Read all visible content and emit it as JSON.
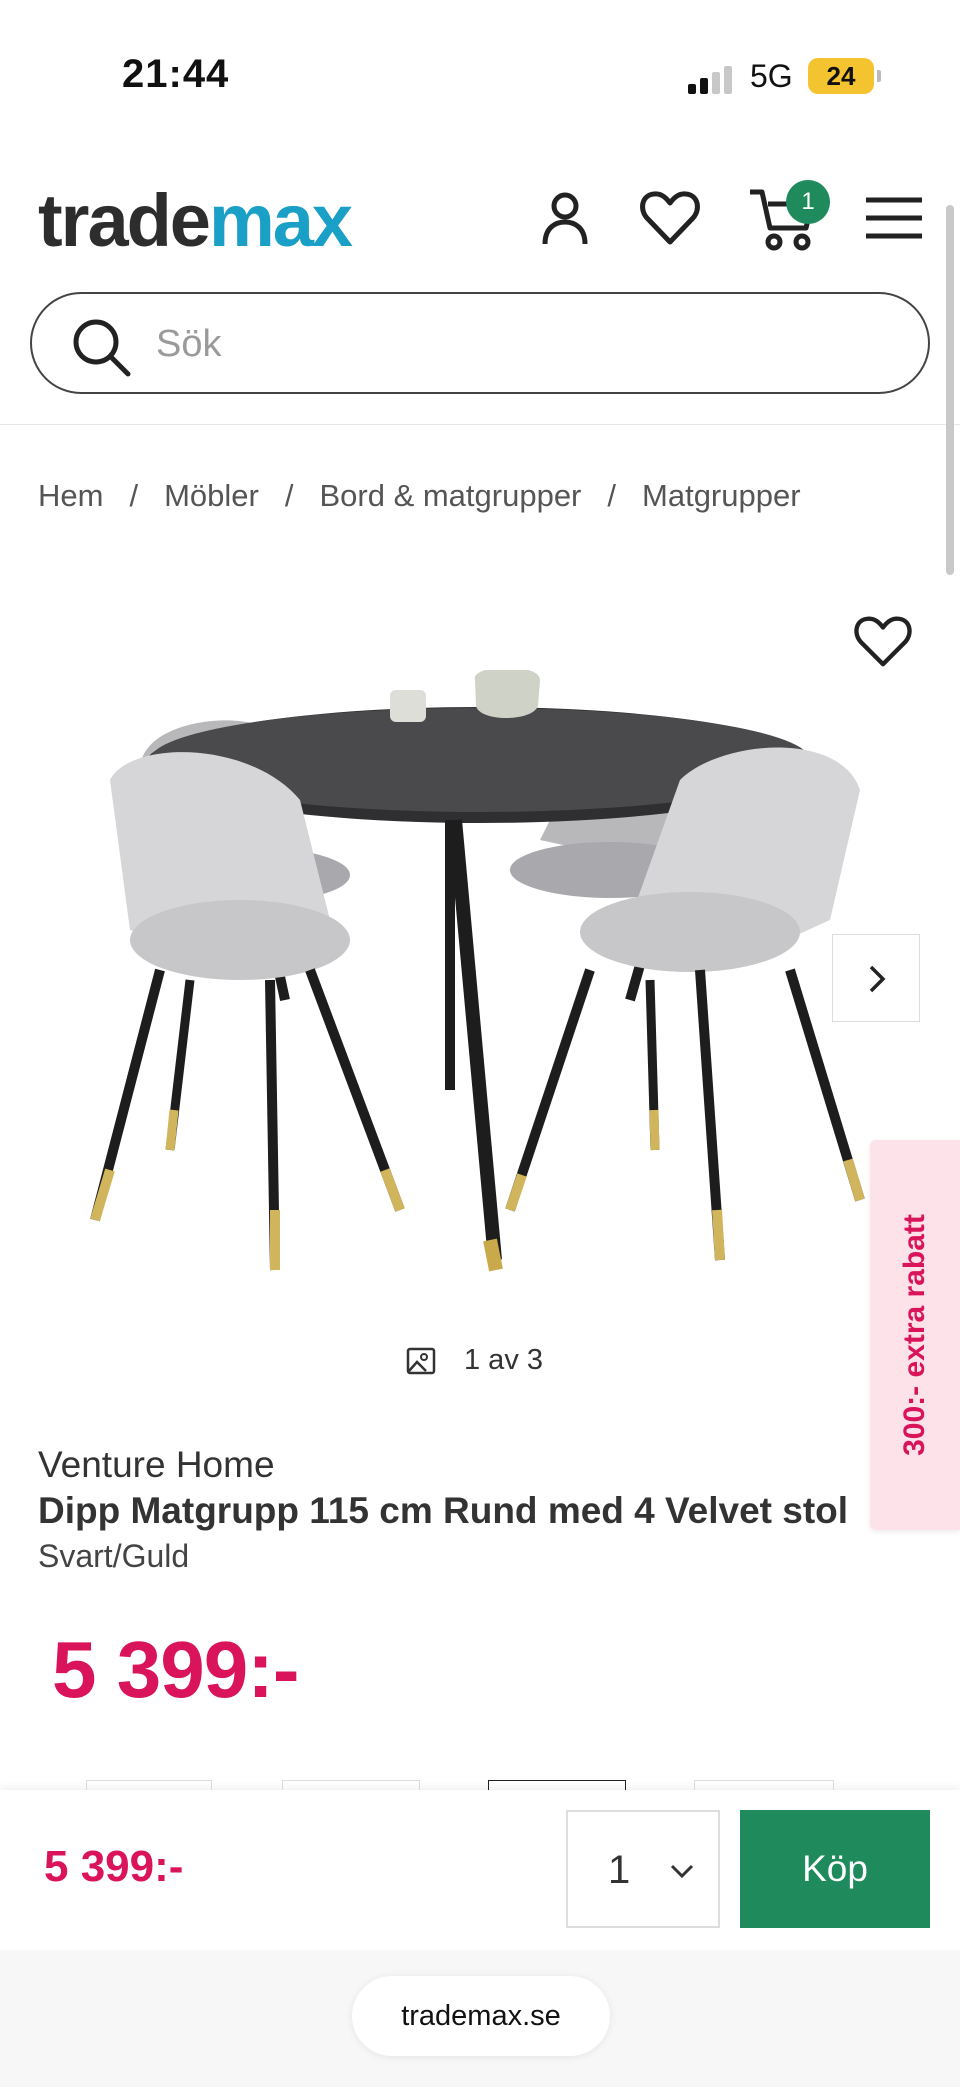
{
  "status_bar": {
    "time": "21:44",
    "network": "5G",
    "battery": "24"
  },
  "header": {
    "logo_part1": "trade",
    "logo_part2": "max",
    "cart_count": "1",
    "icons": [
      "account-icon",
      "heart-icon",
      "cart-icon",
      "menu-icon"
    ]
  },
  "search": {
    "placeholder": "Sök"
  },
  "breadcrumb": [
    {
      "label": "Hem"
    },
    {
      "label": "Möbler"
    },
    {
      "label": "Bord & matgrupper"
    },
    {
      "label": "Matgrupper"
    }
  ],
  "gallery": {
    "counter": "1 av 3",
    "promo": "300:- extra rabatt"
  },
  "product": {
    "brand": "Venture Home",
    "title": "Dipp Matgrupp 115 cm Rund med 4 Velvet stol",
    "color": "Svart/Guld",
    "price": "5 399:-"
  },
  "buy_bar": {
    "price": "5 399:-",
    "quantity": "1",
    "buy_label": "Köp"
  },
  "browser": {
    "url": "trademax.se"
  },
  "colors": {
    "brand_blue": "#1aa0c6",
    "price_pink": "#d9145a",
    "buy_green": "#1f8a5b"
  }
}
